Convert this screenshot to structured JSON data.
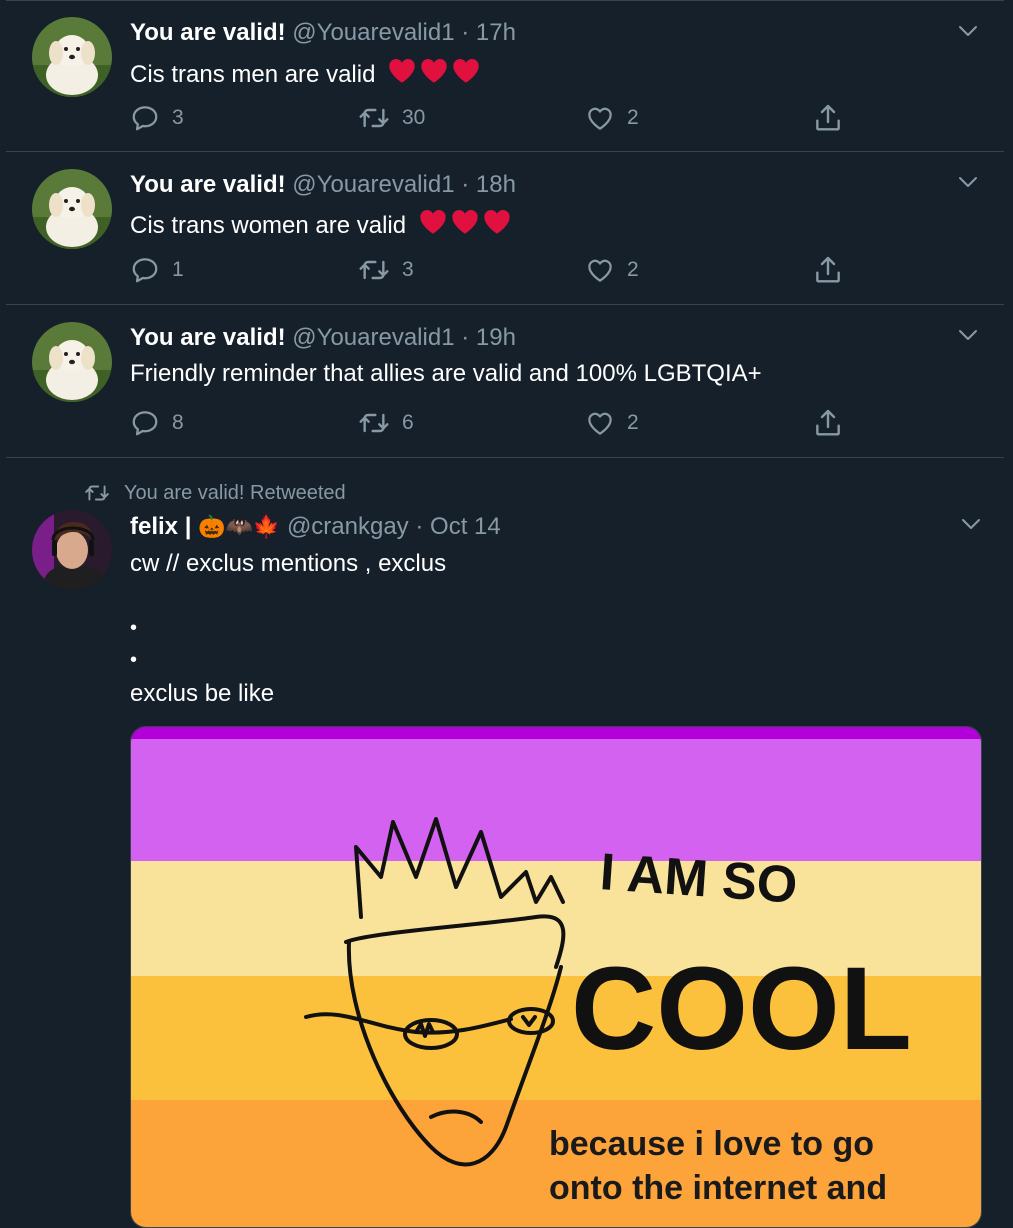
{
  "tweets": [
    {
      "name": "You are valid!",
      "handle": "@Youarevalid1",
      "dot": "·",
      "time": "17h",
      "text": "Cis trans men are valid",
      "emoji": "❤️❤️❤️",
      "replies": "3",
      "retweets": "30",
      "likes": "2"
    },
    {
      "name": "You are valid!",
      "handle": "@Youarevalid1",
      "dot": "·",
      "time": "18h",
      "text": "Cis trans women are valid",
      "emoji": "❤️❤️❤️",
      "replies": "1",
      "retweets": "3",
      "likes": "2"
    },
    {
      "name": "You are valid!",
      "handle": "@Youarevalid1",
      "dot": "·",
      "time": "19h",
      "text": "Friendly reminder that allies are valid and 100% LGBTQIA+",
      "replies": "8",
      "retweets": "6",
      "likes": "2"
    }
  ],
  "retweet": {
    "banner": "You are valid! Retweeted",
    "name": "felix |",
    "name_emoji": "🎃🦇🍁",
    "handle": "@crankgay",
    "dot": "·",
    "time": "Oct 14",
    "line1": "cw // exclus mentions , exclus",
    "bullet1": "•",
    "bullet2": "•",
    "line2": "exclus be like",
    "image_text": {
      "top": "I AM SO",
      "big": "COOL",
      "bottom1": "because i love to go",
      "bottom2": "onto the internet and"
    },
    "flag_colors": [
      "#d462f0",
      "#f9e29a",
      "#fbc13d",
      "#fca33a"
    ]
  },
  "icons": {
    "reply": "speech-bubble-icon",
    "retweet": "retweet-icon",
    "like": "heart-outline-icon",
    "share": "share-upload-icon",
    "menu": "chevron-down-icon"
  }
}
